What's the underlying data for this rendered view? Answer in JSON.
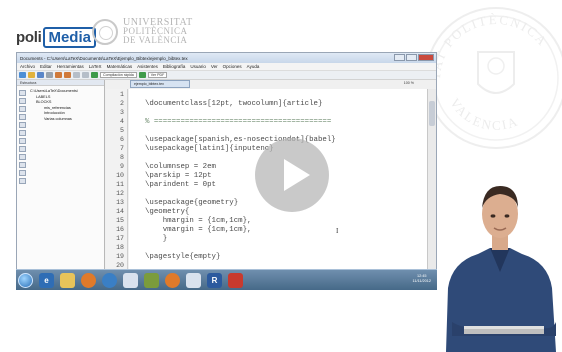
{
  "brand": {
    "poli": "poli",
    "media": "Media"
  },
  "university": {
    "line1": "UNIVERSITAT",
    "line2": "POLITÈCNICA",
    "line3": "DE VALÈNCIA"
  },
  "seal": {
    "top_text": "TAT POLITÈCNICA",
    "bottom_text": "VALENCIA"
  },
  "window": {
    "title": "Documents - C:\\Users\\LaTeX\\Documents\\LaTeX\\Ejemplo_Bibtex\\ejemplo_bibtex.tex",
    "menu": [
      "Archivo",
      "Editar",
      "Herramientas",
      "LaTeX",
      "Matemáticas",
      "Asistentes",
      "Bibliografía",
      "Usuario",
      "Ver",
      "Opciones",
      "Ayuda"
    ],
    "toolbar_dropdown": "Compilación rápida",
    "toolbar_view": "Ver PDF",
    "doc_tab": "ejemplo_bibtex.tex",
    "zoom": "100 %",
    "left_panel_title": "Estructura"
  },
  "structure_tree": [
    {
      "label": "C:\\Users\\LaTeX\\Documents\\",
      "level": 0
    },
    {
      "label": "LABELS",
      "level": 1
    },
    {
      "label": "BLOCKS",
      "level": 1
    },
    {
      "label": "mis_referencias",
      "level": 2
    },
    {
      "label": "Introducción",
      "level": 2
    },
    {
      "label": "Varias columnas",
      "level": 2
    }
  ],
  "code_lines": [
    {
      "n": "1",
      "text": ""
    },
    {
      "n": "2",
      "text": "\\documentclass[12pt, twocolumn]{article}"
    },
    {
      "n": "3",
      "text": ""
    },
    {
      "n": "4",
      "text": "% ========================================"
    },
    {
      "n": "5",
      "text": ""
    },
    {
      "n": "6",
      "text": "\\usepackage[spanish,es-nosectiondot]{babel}"
    },
    {
      "n": "7",
      "text": "\\usepackage[latin1]{inputenc}"
    },
    {
      "n": "8",
      "text": ""
    },
    {
      "n": "9",
      "text": "\\columnsep = 2em"
    },
    {
      "n": "10",
      "text": "\\parskip = 12pt"
    },
    {
      "n": "11",
      "text": "\\parindent = 0pt"
    },
    {
      "n": "12",
      "text": ""
    },
    {
      "n": "13",
      "text": "\\usepackage{geometry}"
    },
    {
      "n": "14",
      "text": "\\geometry{"
    },
    {
      "n": "15",
      "text": "    hmargin = {1cm,1cm},"
    },
    {
      "n": "16",
      "text": "    vmargin = {1cm,1cm},"
    },
    {
      "n": "17",
      "text": "    }"
    },
    {
      "n": "18",
      "text": ""
    },
    {
      "n": "19",
      "text": "\\pagestyle{empty}"
    },
    {
      "n": "20",
      "text": ""
    }
  ],
  "status": {
    "tabs": [
      "Estructura",
      "Mensajes / Log",
      "Source Viewer",
      "Ready"
    ],
    "encoding": "ISO-8859-1",
    "mode": "Modo normal"
  },
  "taskbar": {
    "time": "12:45",
    "date": "11/11/2012"
  },
  "player": {
    "icon": "play-icon"
  }
}
